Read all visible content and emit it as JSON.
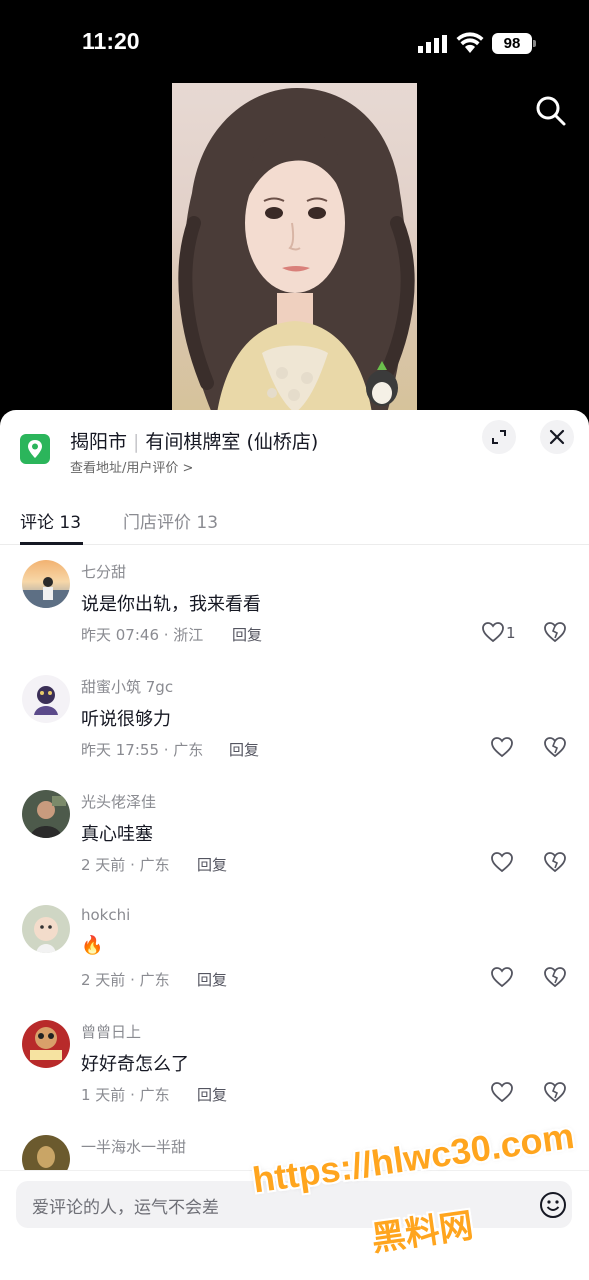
{
  "status_bar": {
    "time": "11:20",
    "battery": "98"
  },
  "video": {
    "image": "portrait photo of a woman with long wavy hair"
  },
  "poi": {
    "city": "揭阳市",
    "store": "有间棋牌室 (仙桥店)",
    "subtitle": "查看地址/用户评价 >",
    "icon": "location-pin-icon"
  },
  "tabs": [
    {
      "label": "评论 13"
    },
    {
      "label": "门店评价 13"
    }
  ],
  "comments": [
    {
      "user": "七分甜",
      "text": "说是你出轨，我来看看",
      "meta": "昨天 07:46 · 浙江",
      "reply": "回复",
      "likes": "1"
    },
    {
      "user": "甜蜜小筑 7gc",
      "text": "听说很够力",
      "meta": "昨天 17:55 · 广东",
      "reply": "回复",
      "likes": ""
    },
    {
      "user": "光头佬泽佳",
      "text": "真心哇塞",
      "meta": "2 天前 · 广东",
      "reply": "回复",
      "likes": ""
    },
    {
      "user": "hokchi",
      "text": "🔥",
      "meta": "2 天前 · 广东",
      "reply": "回复",
      "likes": ""
    },
    {
      "user": "曾曾日上",
      "text": "好好奇怎么了",
      "meta": "1 天前 · 广东",
      "reply": "回复",
      "likes": ""
    },
    {
      "user": "一半海水一半甜",
      "text": "",
      "meta": "",
      "reply": "",
      "likes": ""
    }
  ],
  "comment_input": {
    "placeholder": "爱评论的人，运气不会差"
  },
  "watermark": {
    "line1": "https://hlwc30.com",
    "line2": "黑料网"
  },
  "colors": {
    "accent_green": "#2bb55b",
    "watermark": "#ffa51e"
  }
}
